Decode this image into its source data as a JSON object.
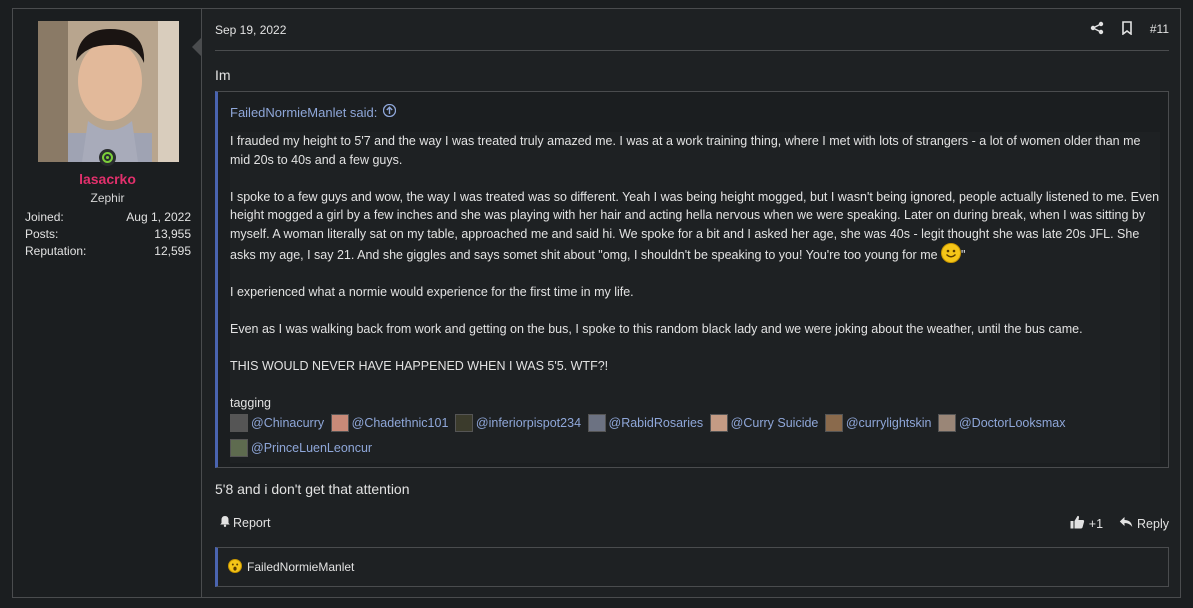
{
  "user": {
    "username": "lasacrko",
    "title": "Zephir",
    "stats": [
      {
        "label": "Joined:",
        "value": "Aug 1, 2022"
      },
      {
        "label": "Posts:",
        "value": "13,955"
      },
      {
        "label": "Reputation:",
        "value": "12,595"
      }
    ],
    "online": true
  },
  "post": {
    "date": "Sep 19, 2022",
    "number": "#11",
    "intro": "Im",
    "quote": {
      "author": "FailedNormieManlet said:",
      "paragraphs": [
        "I frauded my height to 5'7 and the way I was treated truly amazed me. I was at a work training thing, where I met with lots of strangers - a lot of women older than me mid 20s to 40s and a few guys.",
        "I spoke to a few guys and wow, the way I was treated was so different. Yeah I was being height mogged, but I wasn't being ignored, people actually listened to me. Even height mogged a girl by a few inches and she was playing with her hair and acting hella nervous when we were speaking. Later on during break, when I was sitting by myself. A woman literally sat on my table, approached me and said hi. We spoke for a bit and I asked her age, she was 40s - legit thought she was late 20s JFL. She asks my age, I say 21. And she giggles and says somet shit about \"omg, I shouldn't be speaking to you! You're too young for me",
        "I experienced what a normie would experience for the first time in my life.",
        "Even as I was walking back from work and getting on the bus, I spoke to this random black lady and we were joking about the weather, until the bus came.",
        "THIS WOULD NEVER HAVE HAPPENED WHEN I WAS 5'5. WTF?!"
      ],
      "quote_close": "\"",
      "tagging_label": "tagging",
      "mentions": [
        "@Chinacurry",
        "@Chadethnic101",
        "@inferiorpispot234",
        "@RabidRosaries",
        "@Curry Suicide",
        "@currylightskin",
        "@DoctorLooksmax",
        "@PrinceLuenLeoncur"
      ]
    },
    "reply_text": "5'8 and i don't get that attention",
    "actions": {
      "report": "Report",
      "like_count": "+1",
      "reply": "Reply"
    },
    "reactions": {
      "names": "FailedNormieManlet"
    }
  },
  "colors": {
    "username": "#e2306c",
    "link": "#8fa7d9",
    "quote_border": "#4a64b0",
    "online": "#7ccf3a"
  },
  "icons": [
    "share-icon",
    "bookmark-icon",
    "up-arrow-icon",
    "bell-icon",
    "thumbs-up-icon",
    "reply-icon",
    "wow-reaction-icon",
    "smile-emoji-icon"
  ]
}
